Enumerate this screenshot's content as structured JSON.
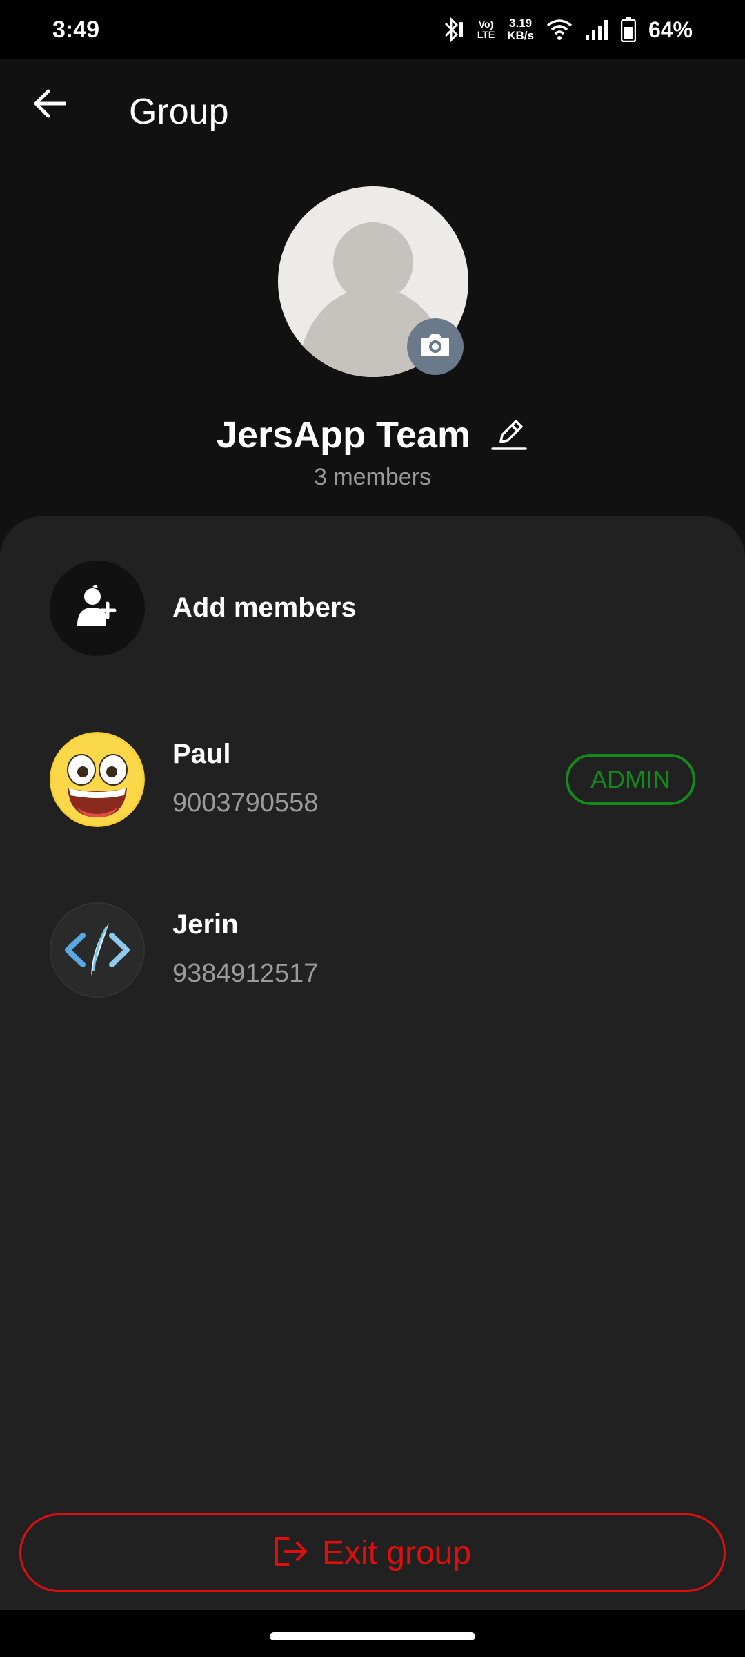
{
  "status_bar": {
    "time": "3:49",
    "volte_top": "Vo)",
    "volte_bottom": "LTE",
    "speed_value": "3.19",
    "speed_unit": "KB/s",
    "battery": "64%",
    "icons": [
      "bluetooth-icon",
      "volte-icon",
      "wifi-icon",
      "signal-icon",
      "battery-icon"
    ]
  },
  "app_bar": {
    "title": "Group",
    "back_icon": "arrow-left-icon"
  },
  "group": {
    "name": "JersApp Team",
    "member_count": "3 members",
    "avatar_icon": "person-placeholder-icon",
    "camera_icon": "camera-icon",
    "edit_icon": "pencil-icon"
  },
  "actions": {
    "add_members_label": "Add members",
    "add_members_icon": "add-person-icon"
  },
  "members": [
    {
      "name": "Paul",
      "phone": "9003790558",
      "badge": "ADMIN",
      "avatar_icon": "grinning-emoji-icon"
    },
    {
      "name": "Jerin",
      "phone": "9384912517",
      "avatar_icon": "code-logo-icon"
    }
  ],
  "exit": {
    "label": "Exit group",
    "icon": "exit-icon"
  },
  "colors": {
    "background": "#111111",
    "sheet": "#212121",
    "admin_green": "#138a1c",
    "exit_red": "#e10e0e",
    "muted_text": "#9a9a9a"
  }
}
